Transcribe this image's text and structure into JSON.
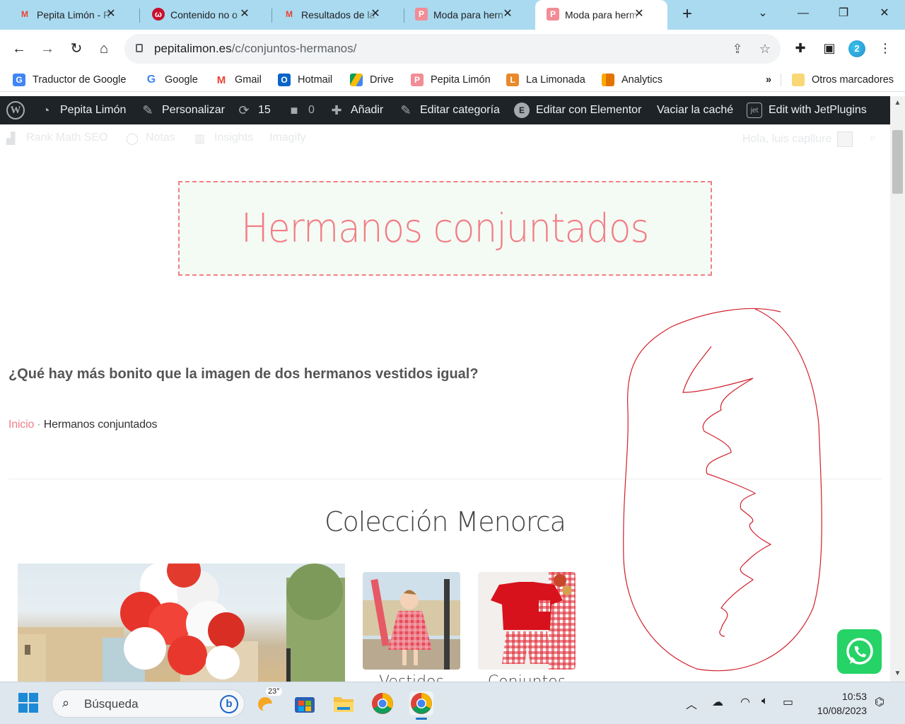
{
  "browser": {
    "tabs": [
      {
        "title": "Pepita Limón - R",
        "favicon": "gmail-icon"
      },
      {
        "title": "Contenido no o",
        "favicon": "wordreference-icon"
      },
      {
        "title": "Resultados de la",
        "favicon": "gmail-icon"
      },
      {
        "title": "Moda para hern",
        "favicon": "pepita-icon"
      },
      {
        "title": "Moda para herm",
        "favicon": "pepita-icon",
        "active": true
      }
    ],
    "url_domain": "pepitalimon.es",
    "url_path": "/c/conjuntos-hermanos/",
    "profile_badge": "2",
    "bookmarks": [
      "Traductor de Google",
      "Google",
      "Gmail",
      "Hotmail",
      "Drive",
      "Pepita Limón",
      "La Limonada",
      "Analytics"
    ],
    "bookmarks_more": "»",
    "other_bookmarks": "Otros marcadores"
  },
  "wp_admin": {
    "site_name": "Pepita Limón",
    "customize": "Personalizar",
    "updates_count": "15",
    "comments_count": "0",
    "add_new": "Añadir",
    "edit_category": "Editar categoría",
    "edit_elementor": "Editar con Elementor",
    "clear_cache": "Vaciar la caché",
    "jetplugins": "Edit with JetPlugins",
    "rank_math": "Rank Math SEO",
    "notes": "Notas",
    "insights": "Insights",
    "imagify": "Imagify",
    "greeting": "Hola, luis capllure"
  },
  "page": {
    "hero_title": "Hermanos conjuntados",
    "question": "¿Qué hay más bonito que la imagen de dos hermanos vestidos igual?",
    "breadcrumb_home": "Inicio",
    "breadcrumb_sep": " · ",
    "breadcrumb_current": "Hermanos conjuntados",
    "collection_title": "Colección Menorca",
    "thumb_labels": [
      "Vestidos",
      "Conjuntos"
    ],
    "accent_color": "#ef7f86"
  },
  "taskbar": {
    "search_placeholder": "Búsqueda",
    "weather": "23°",
    "time": "10:53",
    "date": "10/08/2023"
  }
}
